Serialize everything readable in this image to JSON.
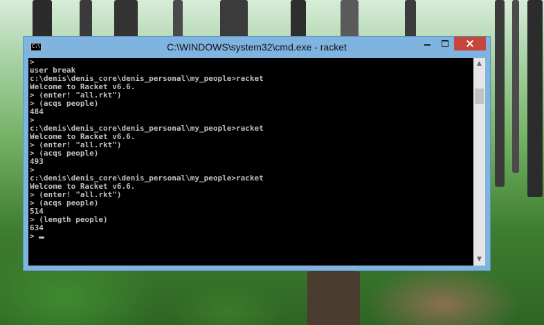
{
  "window": {
    "title": "C:\\WINDOWS\\system32\\cmd.exe - racket",
    "icon_text": "C:\\"
  },
  "console": {
    "lines": [
      ">",
      "user break",
      "",
      "c:\\denis\\denis_core\\denis_personal\\my_people>racket",
      "Welcome to Racket v6.6.",
      "> (enter! \"all.rkt\")",
      "> (acqs people)",
      "484",
      ">",
      "",
      "c:\\denis\\denis_core\\denis_personal\\my_people>racket",
      "Welcome to Racket v6.6.",
      "> (enter! \"all.rkt\")",
      "> (acqs people)",
      "493",
      ">",
      "",
      "c:\\denis\\denis_core\\denis_personal\\my_people>racket",
      "Welcome to Racket v6.6.",
      "> (enter! \"all.rkt\")",
      "> (acqs people)",
      "514",
      "> (length people)",
      "634"
    ],
    "prompt": "> "
  },
  "colors": {
    "titlebar": "#7fb3e0",
    "close_button": "#c7453b",
    "console_bg": "#000000",
    "console_text": "#c0c0c0"
  }
}
